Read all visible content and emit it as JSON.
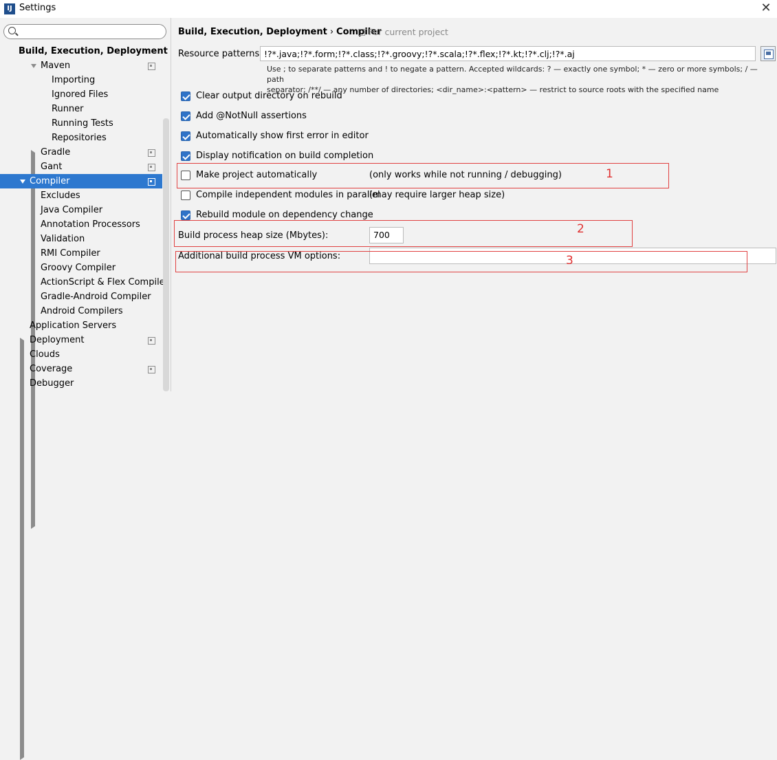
{
  "window": {
    "title": "Settings",
    "app_icon_text": "IJ",
    "close_glyph": "✕"
  },
  "search": {
    "placeholder": "",
    "value": ""
  },
  "tree": [
    {
      "label": "Build, Execution, Deployment",
      "level": 0,
      "bold": true
    },
    {
      "label": "Maven",
      "level": 1,
      "arrow": "down",
      "project_icon": true
    },
    {
      "label": "Importing",
      "level": 2
    },
    {
      "label": "Ignored Files",
      "level": 2
    },
    {
      "label": "Runner",
      "level": 2
    },
    {
      "label": "Running Tests",
      "level": 2
    },
    {
      "label": "Repositories",
      "level": 2
    },
    {
      "label": "Gradle",
      "level": 1,
      "arrow": "right",
      "project_icon": true
    },
    {
      "label": "Gant",
      "level": 1,
      "project_icon": true
    },
    {
      "label": "Compiler",
      "level": 1,
      "arrow": "down",
      "project_icon": true,
      "selected": true
    },
    {
      "label": "Excludes",
      "level": 2
    },
    {
      "label": "Java Compiler",
      "level": 2
    },
    {
      "label": "Annotation Processors",
      "level": 2
    },
    {
      "label": "Validation",
      "level": 2
    },
    {
      "label": "RMI Compiler",
      "level": 2
    },
    {
      "label": "Groovy Compiler",
      "level": 2
    },
    {
      "label": "ActionScript & Flex Compiler",
      "level": 2
    },
    {
      "label": "Gradle-Android Compiler",
      "level": 2
    },
    {
      "label": "Android Compilers",
      "level": 2
    },
    {
      "label": "Application Servers",
      "level": 1
    },
    {
      "label": "Deployment",
      "level": 1,
      "arrow": "right",
      "project_icon": true
    },
    {
      "label": "Clouds",
      "level": 1
    },
    {
      "label": "Coverage",
      "level": 1,
      "project_icon": true
    },
    {
      "label": "Debugger",
      "level": 1,
      "arrow": "right"
    }
  ],
  "breadcrumb": {
    "part1": "Build, Execution, Deployment",
    "separator": "›",
    "part2": "Compiler"
  },
  "for_current_project": "For current project",
  "resource_patterns": {
    "label": "Resource patterns:",
    "value": "!?*.java;!?*.form;!?*.class;!?*.groovy;!?*.scala;!?*.flex;!?*.kt;!?*.clj;!?*.aj",
    "hint_line1": "Use ; to separate patterns and ! to negate a pattern. Accepted wildcards: ? — exactly one symbol; * — zero or more symbols; / — path",
    "hint_line2": "separator; /**/ — any number of directories; <dir_name>:<pattern> — restrict to source roots with the specified name"
  },
  "options": [
    {
      "label": "Clear output directory on rebuild",
      "checked": true,
      "note": ""
    },
    {
      "label": "Add @NotNull assertions",
      "checked": true,
      "note": ""
    },
    {
      "label": "Automatically show first error in editor",
      "checked": true,
      "note": ""
    },
    {
      "label": "Display notification on build completion",
      "checked": true,
      "note": ""
    },
    {
      "label": "Make project automatically",
      "checked": false,
      "note": "(only works while not running / debugging)"
    },
    {
      "label": "Compile independent modules in parallel",
      "checked": false,
      "note": "(may require larger heap size)"
    },
    {
      "label": "Rebuild module on dependency change",
      "checked": true,
      "note": ""
    }
  ],
  "heap": {
    "label": "Build process heap size (Mbytes):",
    "value": "700"
  },
  "vm_options": {
    "label": "Additional build process VM options:",
    "value": ""
  },
  "annotations": {
    "n1": "1",
    "n2": "2",
    "n3": "3",
    "color": "#e04040"
  }
}
